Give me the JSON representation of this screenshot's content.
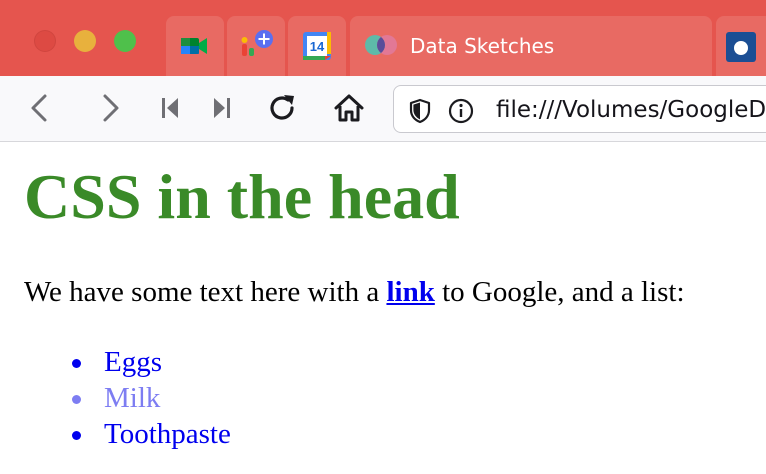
{
  "browser": {
    "tabs": {
      "pinned": [
        {
          "icon": "google-meet-icon"
        },
        {
          "icon": "google-people-add-icon"
        },
        {
          "icon": "google-calendar-icon",
          "badge": "14"
        }
      ],
      "active": {
        "title": "Data Sketches",
        "icon": "data-sketches-icon"
      },
      "next": {
        "icon": "next-tab-favicon"
      }
    },
    "toolbar": {
      "buttons": [
        "back-icon",
        "forward-icon",
        "skip-back-icon",
        "skip-forward-icon",
        "reload-icon",
        "home-icon"
      ],
      "url": "file:///Volumes/GoogleDrive/"
    },
    "colors": {
      "tabstrip": "#e5554e",
      "active_tab": "#e86a63"
    }
  },
  "page": {
    "heading": "CSS in the head",
    "para_before": "We have some text here with a ",
    "link": "link",
    "para_after": " to Google, and a list:",
    "list": [
      "Eggs",
      "Milk",
      "Toothpaste"
    ],
    "colors": {
      "heading": "#3a8a28",
      "link": "#0000ee",
      "list_item": "#0000ee",
      "list_item_muted": "#7d7df2"
    }
  }
}
